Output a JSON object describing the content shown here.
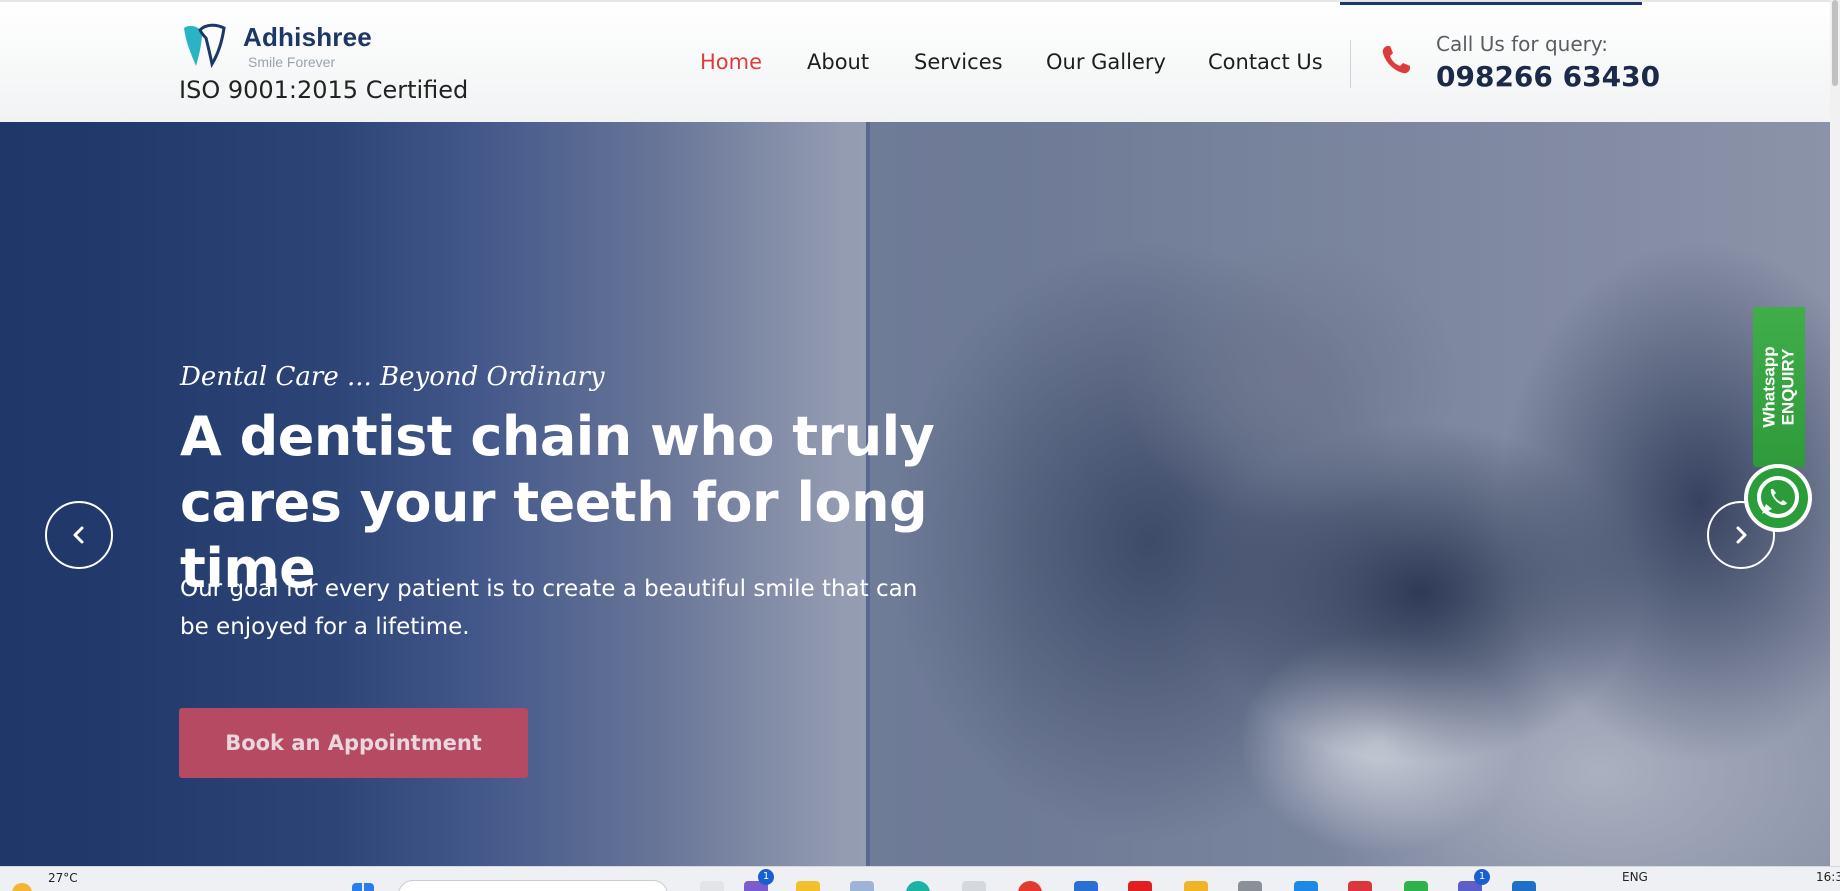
{
  "header": {
    "logo_name": "Adhishree",
    "logo_tagline": "Smile Forever",
    "certification": "ISO 9001:2015 Certified",
    "nav": [
      {
        "label": "Home",
        "active": true
      },
      {
        "label": "About",
        "active": false
      },
      {
        "label": "Services",
        "active": false
      },
      {
        "label": "Our Gallery",
        "active": false
      },
      {
        "label": "Contact Us",
        "active": false
      }
    ],
    "call_label": "Call Us for query:",
    "call_number": "098266 63430"
  },
  "hero": {
    "tagline": "Dental Care ... Beyond Ordinary",
    "headline": "A dentist chain who truly cares your teeth for long time",
    "subtext": "Our goal for every patient is to create a beautiful smile that can be enjoyed for a lifetime.",
    "cta_label": "Book an Appointment"
  },
  "whatsapp": {
    "line1": "Whatsapp",
    "line2": "ENQUIRY"
  },
  "taskbar": {
    "temperature": "27°C",
    "language": "ENG",
    "time": "16:3",
    "badges": [
      "1",
      "1"
    ]
  },
  "colors": {
    "brand_navy": "#1d3766",
    "nav_active": "#e03b3b",
    "cta": "#b64a63",
    "whatsapp_green": "#3fae49"
  },
  "icons": [
    "tooth-logo-icon",
    "phone-icon",
    "chevron-left-icon",
    "chevron-right-icon",
    "whatsapp-icon",
    "windows-start-icon",
    "weather-icon"
  ]
}
